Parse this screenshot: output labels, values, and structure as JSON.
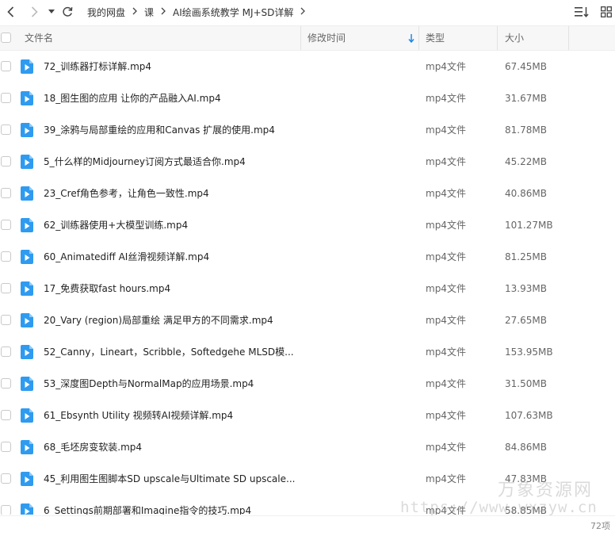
{
  "breadcrumb": [
    "我的网盘",
    "课",
    "AI绘画系统教学 MJ+SD详解"
  ],
  "columns": {
    "name": "文件名",
    "modified": "修改时间",
    "type": "类型",
    "size": "大小"
  },
  "files": [
    {
      "name": "72_训练器打标详解.mp4",
      "type": "mp4文件",
      "size": "67.45MB"
    },
    {
      "name": "18_图生图的应用 让你的产品融入AI.mp4",
      "type": "mp4文件",
      "size": "31.67MB"
    },
    {
      "name": "39_涂鸦与局部重绘的应用和Canvas 扩展的使用.mp4",
      "type": "mp4文件",
      "size": "81.78MB"
    },
    {
      "name": "5_什么样的Midjourney订阅方式最适合你.mp4",
      "type": "mp4文件",
      "size": "45.22MB"
    },
    {
      "name": "23_Cref角色参考，让角色一致性.mp4",
      "type": "mp4文件",
      "size": "40.86MB"
    },
    {
      "name": "62_训练器使用+大模型训练.mp4",
      "type": "mp4文件",
      "size": "101.27MB"
    },
    {
      "name": "60_Animatediff AI丝滑视频详解.mp4",
      "type": "mp4文件",
      "size": "81.25MB"
    },
    {
      "name": "17_免费获取fast hours.mp4",
      "type": "mp4文件",
      "size": "13.93MB"
    },
    {
      "name": "20_Vary (region)局部重绘 满足甲方的不同需求.mp4",
      "type": "mp4文件",
      "size": "27.65MB"
    },
    {
      "name": "52_Canny，Lineart，Scribble，Softedgehe MLSD模...",
      "type": "mp4文件",
      "size": "153.95MB"
    },
    {
      "name": "53_深度图Depth与NormalMap的应用场景.mp4",
      "type": "mp4文件",
      "size": "31.50MB"
    },
    {
      "name": "61_Ebsynth Utility 视频转AI视频详解.mp4",
      "type": "mp4文件",
      "size": "107.63MB"
    },
    {
      "name": "68_毛坯房变软装.mp4",
      "type": "mp4文件",
      "size": "84.86MB"
    },
    {
      "name": "45_利用图生图脚本SD upscale与Ultimate SD upscale...",
      "type": "mp4文件",
      "size": "47.83MB"
    },
    {
      "name": "6_Settings前期部署和Imagine指令的技巧.mp4",
      "type": "mp4文件",
      "size": "58.85MB"
    }
  ],
  "footer": {
    "count": "72项"
  },
  "watermark": {
    "line1": "万象资源网",
    "line2": "https://www.wxzyw.cn"
  },
  "colors": {
    "accent": "#1e88e5",
    "video_icon": "#2f9bf0"
  },
  "icons": [
    "back-icon",
    "forward-icon",
    "dropdown-icon",
    "refresh-icon",
    "sort-list-icon",
    "grid-view-icon",
    "video-file-icon",
    "sort-down-icon"
  ]
}
